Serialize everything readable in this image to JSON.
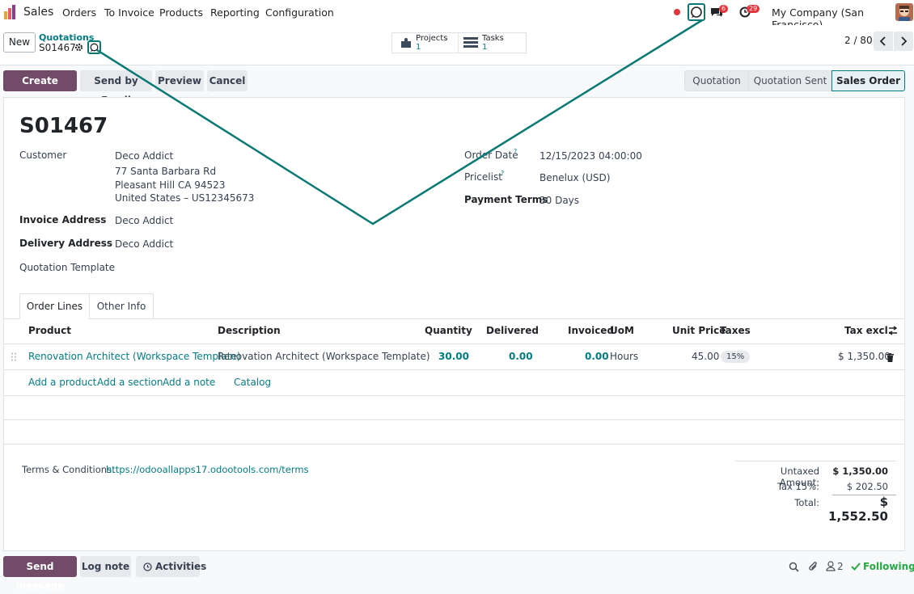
{
  "navbar": {
    "app_name": "Sales",
    "menu": [
      "Orders",
      "To Invoice",
      "Products",
      "Reporting",
      "Configuration"
    ],
    "messages_badge": "6",
    "activities_badge": "29",
    "company": "My Company (San Francisco)"
  },
  "control": {
    "new_label": "New",
    "breadcrumb_parent": "Quotations",
    "record_name": "S01467",
    "smart_buttons": [
      {
        "label": "Projects",
        "count": "1"
      },
      {
        "label": "Tasks",
        "count": "1"
      }
    ],
    "pager": "2 / 80"
  },
  "actions": {
    "create_invoice": "Create Invoice",
    "send_email": "Send by Email",
    "preview": "Preview",
    "cancel": "Cancel"
  },
  "statusbar": [
    "Quotation",
    "Quotation Sent",
    "Sales Order"
  ],
  "order": {
    "name": "S01467",
    "customer_label": "Customer",
    "customer_name": "Deco Addict",
    "address_line1": "77 Santa Barbara Rd",
    "address_line2": "Pleasant Hill CA 94523",
    "address_line3": "United States – US12345673",
    "invoice_address_label": "Invoice Address",
    "invoice_address": "Deco Addict",
    "delivery_address_label": "Delivery Address",
    "delivery_address": "Deco Addict",
    "template_label": "Quotation Template",
    "order_date_label": "Order Date",
    "order_date": "12/15/2023 04:00:00",
    "pricelist_label": "Pricelist",
    "pricelist": "Benelux (USD)",
    "payment_terms_label": "Payment Terms",
    "payment_terms": "30 Days",
    "help_mark": "?"
  },
  "tabs": [
    "Order Lines",
    "Other Info"
  ],
  "lines": {
    "headers": {
      "product": "Product",
      "description": "Description",
      "quantity": "Quantity",
      "delivered": "Delivered",
      "invoiced": "Invoiced",
      "uom": "UoM",
      "unit_price": "Unit Price",
      "taxes": "Taxes",
      "tax_excl": "Tax excl."
    },
    "rows": [
      {
        "product": "Renovation Architect (Workspace Template)",
        "description": "Renovation Architect (Workspace Template)",
        "quantity": "30.00",
        "delivered": "0.00",
        "invoiced": "0.00",
        "uom": "Hours",
        "unit_price": "45.00",
        "tax": "15%",
        "subtotal": "$ 1,350.00"
      }
    ],
    "add_product": "Add a product",
    "add_section": "Add a section",
    "add_note": "Add a note",
    "catalog": "Catalog"
  },
  "terms": {
    "label": "Terms & Conditions:",
    "url": "https://odooallapps17.odootools.com/terms"
  },
  "totals": {
    "untaxed_label": "Untaxed Amount:",
    "untaxed": "$ 1,350.00",
    "tax_label": "Tax 15%:",
    "tax": "$ 202.50",
    "total_label": "Total:",
    "total": "$ 1,552.50"
  },
  "chatter": {
    "send_message": "Send message",
    "log_note": "Log note",
    "activities": "Activities",
    "followers": "2",
    "following": "Following"
  },
  "colors": {
    "brand": "#714b67",
    "link": "#017e84",
    "badge": "#e4343b",
    "annotation": "#0b7a75"
  },
  "icons": [
    "sales-app-icon",
    "record-dot-icon",
    "chat-bubble-icon",
    "messages-icon",
    "activity-clock-icon",
    "user-avatar",
    "gear-icon",
    "puzzle-icon",
    "tasks-icon",
    "chevron-left-icon",
    "chevron-right-icon",
    "drag-handle-icon",
    "trash-icon",
    "column-options-icon",
    "search-icon",
    "paperclip-icon",
    "follower-icon",
    "check-icon",
    "clock-icon"
  ]
}
